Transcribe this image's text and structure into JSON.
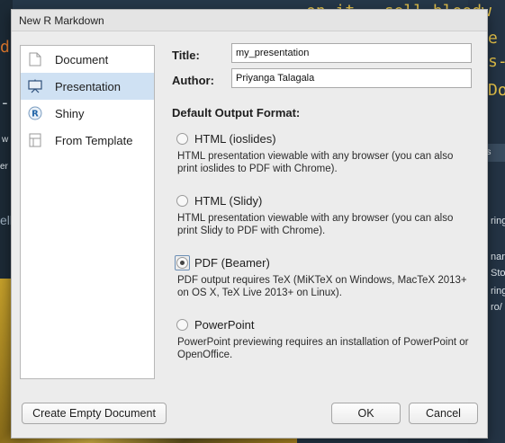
{
  "background": {
    "code_lines": [
      "on it - sell bloodw",
      "d.",
      "-S",
      "e F",
      "s-",
      "Do"
    ],
    "side_labels": [
      "w",
      "er",
      "ns",
      "ell"
    ],
    "right_text": [
      "ring",
      "nan.",
      "Sto",
      "ring",
      "ro/"
    ]
  },
  "dialog": {
    "title": "New R Markdown"
  },
  "sidebar": {
    "items": [
      {
        "label": "Document",
        "icon": "document-icon",
        "selected": false
      },
      {
        "label": "Presentation",
        "icon": "presentation-icon",
        "selected": true
      },
      {
        "label": "Shiny",
        "icon": "shiny-r-icon",
        "selected": false
      },
      {
        "label": "From Template",
        "icon": "template-icon",
        "selected": false
      }
    ]
  },
  "form": {
    "title_label": "Title:",
    "title_value": "my_presentation",
    "author_label": "Author:",
    "author_value": "Priyanga Talagala"
  },
  "output_format": {
    "heading": "Default Output Format:",
    "options": [
      {
        "label": "HTML (ioslides)",
        "description": "HTML presentation viewable with any browser (you can also print ioslides to PDF with Chrome).",
        "checked": false
      },
      {
        "label": "HTML (Slidy)",
        "description": "HTML presentation viewable with any browser (you can also print Slidy to PDF with Chrome).",
        "checked": false
      },
      {
        "label": "PDF (Beamer)",
        "description": "PDF output requires TeX (MiKTeX on Windows, MacTeX 2013+ on OS X, TeX Live 2013+ on Linux).",
        "checked": true
      },
      {
        "label": "PowerPoint",
        "description": "PowerPoint previewing requires an installation of PowerPoint or OpenOffice.",
        "checked": false
      }
    ]
  },
  "buttons": {
    "create_empty": "Create Empty Document",
    "ok": "OK",
    "cancel": "Cancel"
  }
}
